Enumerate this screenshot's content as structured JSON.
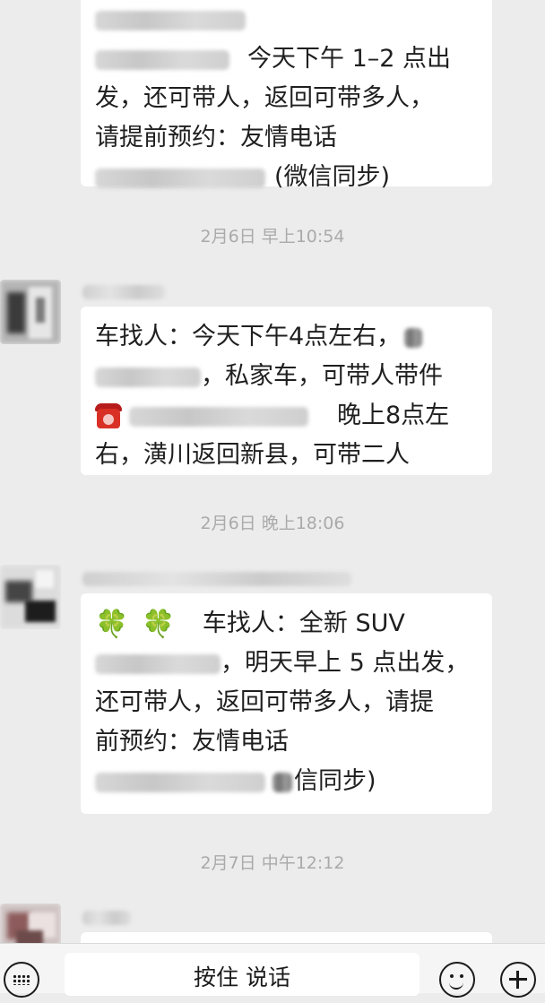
{
  "messages": [
    {
      "lines": [
        {
          "text": "今天下午 1–2 点出"
        },
        {
          "text": "发，还可带人，返回可带多人，"
        },
        {
          "text": "请提前预约：友情电话"
        },
        {
          "text": "(微信同步)"
        }
      ]
    },
    {
      "time": "2月6日 早上10:54",
      "lines": [
        {
          "text": "车找人：今天下午4点左右，"
        },
        {
          "text": "，私家车，可带人带件"
        },
        {
          "text": "晚上8点左"
        },
        {
          "text": "右，潢川返回新县，可带二人"
        }
      ]
    },
    {
      "time": "2月6日 晚上18:06",
      "clover_icon": "🍀",
      "lines": [
        {
          "text": "车找人：全新 SUV"
        },
        {
          "text": "，明天早上 5 点出发，"
        },
        {
          "text": "还可带人，返回可带多人，请提"
        },
        {
          "text": "前预约：友情电话"
        },
        {
          "text": "信同步)"
        }
      ]
    },
    {
      "time": "2月7日 中午12:12"
    }
  ],
  "input_bar": {
    "hold_to_talk_label": "按住 说话"
  },
  "icons": {
    "keyboard": "keyboard-icon",
    "emoji": "emoji-icon",
    "plus": "plus-icon",
    "clover": "clover-icon",
    "phone": "phone-icon"
  },
  "colors": {
    "chat_background": "#ececec",
    "bubble_background": "#ffffff",
    "timestamp_text": "#aaaaaa",
    "clover_green": "#3fae34",
    "phone_red": "#d93025"
  }
}
